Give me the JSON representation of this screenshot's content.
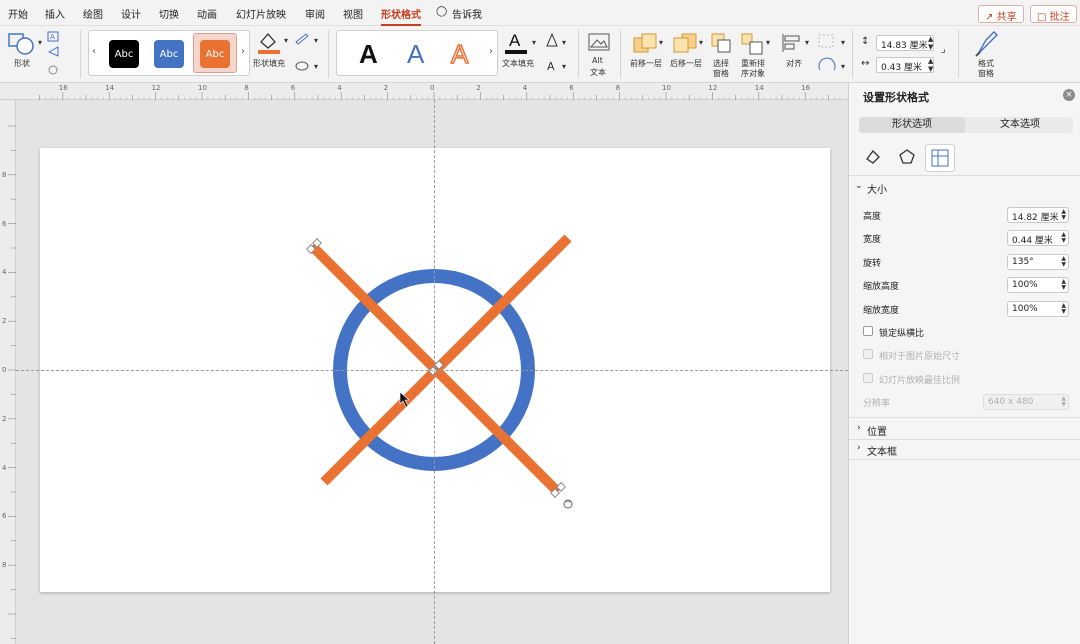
{
  "menubar": {
    "items": [
      "开始",
      "插入",
      "绘图",
      "设计",
      "切换",
      "动画",
      "幻灯片放映",
      "审阅",
      "视图",
      "形状格式",
      "告诉我"
    ],
    "active": "形状格式",
    "share_label": "共享",
    "comments_label": "批注"
  },
  "ribbon": {
    "shape_label": "形状",
    "style_swatch_text": "Abc",
    "shape_fill_label": "形状填充",
    "text_fill_label": "文本填充",
    "alt_text_label": "Alt\n文本",
    "alt_text_line1": "Alt",
    "alt_text_line2": "文本",
    "bring_forward_label": "前移一层",
    "send_backward_label": "后移一层",
    "selection_pane_line1": "选择",
    "selection_pane_line2": "窗格",
    "reorder_line1": "重新排",
    "reorder_line2": "序对象",
    "align_label": "对齐",
    "height_value": "14.83 厘米",
    "width_value": "0.43 厘米",
    "format_pane_line1": "格式",
    "format_pane_line2": "窗格",
    "wordart_letter": "A",
    "colors": {
      "accent_orange": "#E97132",
      "accent_blue": "#4472C4",
      "active_red": "#C43E1C"
    }
  },
  "ruler": {
    "h_ticks": [
      "16",
      "14",
      "12",
      "10",
      "8",
      "6",
      "4",
      "2",
      "0",
      "2",
      "4",
      "6",
      "8",
      "10",
      "12",
      "14",
      "16"
    ],
    "v_ticks": [
      "8",
      "6",
      "4",
      "2",
      "0",
      "2",
      "4",
      "6",
      "8"
    ]
  },
  "pane": {
    "title": "设置形状格式",
    "tab_shape": "形状选项",
    "tab_text": "文本选项",
    "section_size": "大小",
    "height_label": "高度",
    "height_value": "14.82 厘米",
    "width_label": "宽度",
    "width_value": "0.44 厘米",
    "rotation_label": "旋转",
    "rotation_value": "135°",
    "scale_height_label": "缩放高度",
    "scale_height_value": "100%",
    "scale_width_label": "缩放宽度",
    "scale_width_value": "100%",
    "lock_aspect_label": "锁定纵横比",
    "relative_label": "相对于图片原始尺寸",
    "best_scale_label": "幻灯片放映最佳比例",
    "resolution_label": "分辨率",
    "resolution_value": "640 x 480",
    "section_position": "位置",
    "section_textbox": "文本框"
  },
  "slide": {
    "circle_color": "#4472C4",
    "bar_color": "#E97132"
  }
}
